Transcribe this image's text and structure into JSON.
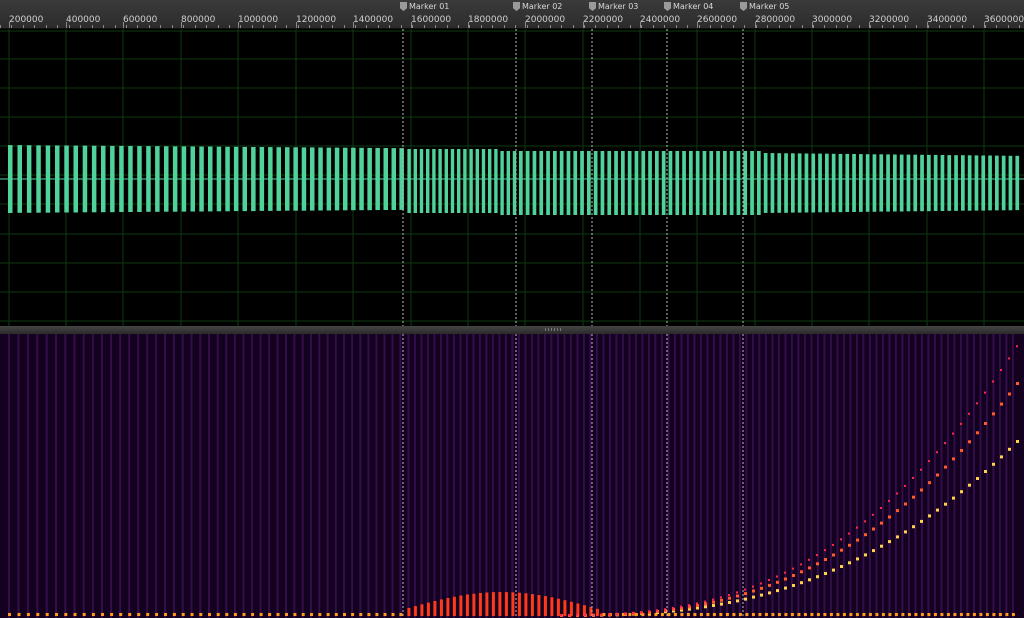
{
  "ruler": {
    "ticks": [
      "200000",
      "400000",
      "600000",
      "800000",
      "1000000",
      "1200000",
      "1400000",
      "1600000",
      "1800000",
      "2000000",
      "2200000",
      "2400000",
      "2600000",
      "2800000",
      "3000000",
      "3200000",
      "3400000",
      "3600000"
    ]
  },
  "markers": [
    {
      "label": "Marker 01",
      "icon": "marker-flag-icon"
    },
    {
      "label": "Marker 02",
      "icon": "marker-flag-icon"
    },
    {
      "label": "Marker 03",
      "icon": "marker-flag-icon"
    },
    {
      "label": "Marker 04",
      "icon": "marker-flag-icon"
    },
    {
      "label": "Marker 05",
      "icon": "marker-flag-icon"
    }
  ],
  "colors": {
    "waveform": "#4fd39a",
    "grid": "#0e3a10",
    "spectrogram_bg": "#14001f",
    "harmonic_hot": "#ffd24a",
    "harmonic_mid": "#ff5a2a"
  }
}
